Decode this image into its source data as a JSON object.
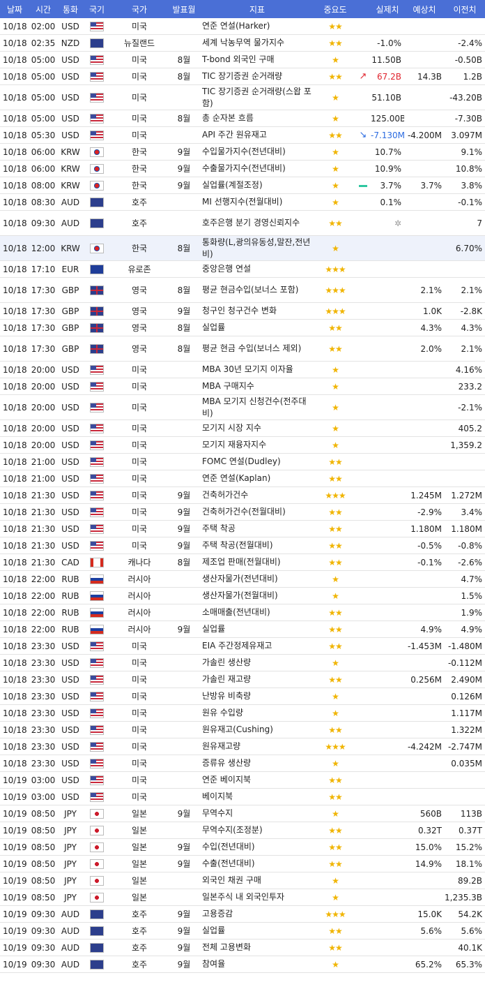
{
  "header": {
    "date": "날짜",
    "time": "시간",
    "currency": "통화",
    "flag": "국기",
    "country": "국가",
    "period": "발표월",
    "indicator": "지표",
    "importance": "중요도",
    "actual": "실제치",
    "forecast": "예상치",
    "previous": "이전치"
  },
  "rows": [
    {
      "date": "10/18",
      "time": "02:00",
      "cur": "USD",
      "flag": "us",
      "country": "미국",
      "period": "",
      "ind": "연준 연설(Harker)",
      "imp": "★★",
      "act": "",
      "fc": "",
      "prev": ""
    },
    {
      "date": "10/18",
      "time": "02:35",
      "cur": "NZD",
      "flag": "nz",
      "country": "뉴질랜드",
      "period": "",
      "ind": "세계 낙농무역 물가지수",
      "imp": "★★",
      "act": "-1.0%",
      "fc": "",
      "prev": "-2.4%"
    },
    {
      "date": "10/18",
      "time": "05:00",
      "cur": "USD",
      "flag": "us",
      "country": "미국",
      "period": "8월",
      "ind": "T-bond 외국인 구매",
      "imp": "★",
      "act": "11.50B",
      "fc": "",
      "prev": "-0.50B"
    },
    {
      "date": "10/18",
      "time": "05:00",
      "cur": "USD",
      "flag": "us",
      "country": "미국",
      "period": "8월",
      "ind": "TIC 장기증권 순거래량",
      "imp": "★★",
      "trend": "up",
      "act": "67.2B",
      "actClass": "neg",
      "fc": "14.3B",
      "prev": "1.2B"
    },
    {
      "date": "10/18",
      "time": "05:00",
      "cur": "USD",
      "flag": "us",
      "country": "미국",
      "period": "",
      "ind": "TIC 장기증권 순거래량(스왑 포함)",
      "imp": "★",
      "act": "51.10B",
      "fc": "",
      "prev": "-43.20B",
      "tall": true
    },
    {
      "date": "10/18",
      "time": "05:00",
      "cur": "USD",
      "flag": "us",
      "country": "미국",
      "period": "8월",
      "ind": "총 순자본 흐름",
      "imp": "★",
      "act": "125.00B",
      "fc": "",
      "prev": "-7.30B"
    },
    {
      "date": "10/18",
      "time": "05:30",
      "cur": "USD",
      "flag": "us",
      "country": "미국",
      "period": "",
      "ind": "API 주간 원유재고",
      "imp": "★★",
      "trend": "down",
      "act": "-7.130M",
      "actClass": "pos",
      "fc": "-4.200M",
      "prev": "3.097M"
    },
    {
      "date": "10/18",
      "time": "06:00",
      "cur": "KRW",
      "flag": "kr",
      "country": "한국",
      "period": "9월",
      "ind": "수입물가지수(전년대비)",
      "imp": "★",
      "act": "10.7%",
      "fc": "",
      "prev": "9.1%"
    },
    {
      "date": "10/18",
      "time": "06:00",
      "cur": "KRW",
      "flag": "kr",
      "country": "한국",
      "period": "9월",
      "ind": "수출물가지수(전년대비)",
      "imp": "★",
      "act": "10.9%",
      "fc": "",
      "prev": "10.8%"
    },
    {
      "date": "10/18",
      "time": "08:00",
      "cur": "KRW",
      "flag": "kr",
      "country": "한국",
      "period": "9월",
      "ind": "실업률(계절조정)",
      "imp": "★",
      "trend": "flat",
      "act": "3.7%",
      "fc": "3.7%",
      "prev": "3.8%"
    },
    {
      "date": "10/18",
      "time": "08:30",
      "cur": "AUD",
      "flag": "au",
      "country": "호주",
      "period": "",
      "ind": "MI 선행지수(전월대비)",
      "imp": "★",
      "act": "0.1%",
      "fc": "",
      "prev": "-0.1%"
    },
    {
      "date": "10/18",
      "time": "09:30",
      "cur": "AUD",
      "flag": "au",
      "country": "호주",
      "period": "",
      "ind": "호주은행 분기 경영신뢰지수",
      "imp": "★★",
      "spinner": true,
      "act": "",
      "fc": "",
      "prev": "7",
      "tall": true
    },
    {
      "date": "10/18",
      "time": "12:00",
      "cur": "KRW",
      "flag": "kr",
      "country": "한국",
      "period": "8월",
      "ind": "통화량(L,광의유동성,말잔,전년비)",
      "imp": "★",
      "act": "",
      "fc": "",
      "prev": "6.70%",
      "tall": true,
      "hl": true
    },
    {
      "date": "10/18",
      "time": "17:10",
      "cur": "EUR",
      "flag": "eu",
      "country": "유로존",
      "period": "",
      "ind": "중앙은행 연설",
      "imp": "★★★",
      "act": "",
      "fc": "",
      "prev": ""
    },
    {
      "date": "10/18",
      "time": "17:30",
      "cur": "GBP",
      "flag": "gb",
      "country": "영국",
      "period": "8월",
      "ind": "평균 현금수입(보너스 포함)",
      "imp": "★★★",
      "act": "",
      "fc": "2.1%",
      "prev": "2.1%",
      "tall": true
    },
    {
      "date": "10/18",
      "time": "17:30",
      "cur": "GBP",
      "flag": "gb",
      "country": "영국",
      "period": "9월",
      "ind": "청구인 청구건수 변화",
      "imp": "★★★",
      "act": "",
      "fc": "1.0K",
      "prev": "-2.8K"
    },
    {
      "date": "10/18",
      "time": "17:30",
      "cur": "GBP",
      "flag": "gb",
      "country": "영국",
      "period": "8월",
      "ind": "실업률",
      "imp": "★★",
      "act": "",
      "fc": "4.3%",
      "prev": "4.3%"
    },
    {
      "date": "10/18",
      "time": "17:30",
      "cur": "GBP",
      "flag": "gb",
      "country": "영국",
      "period": "8월",
      "ind": "평균 현금 수입(보너스 제외)",
      "imp": "★★",
      "act": "",
      "fc": "2.0%",
      "prev": "2.1%",
      "tall": true
    },
    {
      "date": "10/18",
      "time": "20:00",
      "cur": "USD",
      "flag": "us",
      "country": "미국",
      "period": "",
      "ind": "MBA 30년 모기지 이자율",
      "imp": "★",
      "act": "",
      "fc": "",
      "prev": "4.16%"
    },
    {
      "date": "10/18",
      "time": "20:00",
      "cur": "USD",
      "flag": "us",
      "country": "미국",
      "period": "",
      "ind": "MBA 구매지수",
      "imp": "★",
      "act": "",
      "fc": "",
      "prev": "233.2"
    },
    {
      "date": "10/18",
      "time": "20:00",
      "cur": "USD",
      "flag": "us",
      "country": "미국",
      "period": "",
      "ind": "MBA 모기지 신청건수(전주대비)",
      "imp": "★",
      "act": "",
      "fc": "",
      "prev": "-2.1%",
      "tall": true
    },
    {
      "date": "10/18",
      "time": "20:00",
      "cur": "USD",
      "flag": "us",
      "country": "미국",
      "period": "",
      "ind": "모기지 시장 지수",
      "imp": "★",
      "act": "",
      "fc": "",
      "prev": "405.2"
    },
    {
      "date": "10/18",
      "time": "20:00",
      "cur": "USD",
      "flag": "us",
      "country": "미국",
      "period": "",
      "ind": "모기지 재융자지수",
      "imp": "★",
      "act": "",
      "fc": "",
      "prev": "1,359.2"
    },
    {
      "date": "10/18",
      "time": "21:00",
      "cur": "USD",
      "flag": "us",
      "country": "미국",
      "period": "",
      "ind": "FOMC 연설(Dudley)",
      "imp": "★★",
      "act": "",
      "fc": "",
      "prev": ""
    },
    {
      "date": "10/18",
      "time": "21:00",
      "cur": "USD",
      "flag": "us",
      "country": "미국",
      "period": "",
      "ind": "연준 연설(Kaplan)",
      "imp": "★★",
      "act": "",
      "fc": "",
      "prev": ""
    },
    {
      "date": "10/18",
      "time": "21:30",
      "cur": "USD",
      "flag": "us",
      "country": "미국",
      "period": "9월",
      "ind": "건축허가건수",
      "imp": "★★★",
      "act": "",
      "fc": "1.245M",
      "prev": "1.272M"
    },
    {
      "date": "10/18",
      "time": "21:30",
      "cur": "USD",
      "flag": "us",
      "country": "미국",
      "period": "9월",
      "ind": "건축허가건수(전월대비)",
      "imp": "★★",
      "act": "",
      "fc": "-2.9%",
      "prev": "3.4%"
    },
    {
      "date": "10/18",
      "time": "21:30",
      "cur": "USD",
      "flag": "us",
      "country": "미국",
      "period": "9월",
      "ind": "주택 착공",
      "imp": "★★",
      "act": "",
      "fc": "1.180M",
      "prev": "1.180M"
    },
    {
      "date": "10/18",
      "time": "21:30",
      "cur": "USD",
      "flag": "us",
      "country": "미국",
      "period": "9월",
      "ind": "주택 착공(전월대비)",
      "imp": "★★",
      "act": "",
      "fc": "-0.5%",
      "prev": "-0.8%"
    },
    {
      "date": "10/18",
      "time": "21:30",
      "cur": "CAD",
      "flag": "ca",
      "country": "캐나다",
      "period": "8월",
      "ind": "제조업 판매(전월대비)",
      "imp": "★★",
      "act": "",
      "fc": "-0.1%",
      "prev": "-2.6%"
    },
    {
      "date": "10/18",
      "time": "22:00",
      "cur": "RUB",
      "flag": "ru",
      "country": "러시아",
      "period": "",
      "ind": "생산자물가(전년대비)",
      "imp": "★",
      "act": "",
      "fc": "",
      "prev": "4.7%"
    },
    {
      "date": "10/18",
      "time": "22:00",
      "cur": "RUB",
      "flag": "ru",
      "country": "러시아",
      "period": "",
      "ind": "생산자물가(전월대비)",
      "imp": "★",
      "act": "",
      "fc": "",
      "prev": "1.5%"
    },
    {
      "date": "10/18",
      "time": "22:00",
      "cur": "RUB",
      "flag": "ru",
      "country": "러시아",
      "period": "",
      "ind": "소매매출(전년대비)",
      "imp": "★★",
      "act": "",
      "fc": "",
      "prev": "1.9%"
    },
    {
      "date": "10/18",
      "time": "22:00",
      "cur": "RUB",
      "flag": "ru",
      "country": "러시아",
      "period": "9월",
      "ind": "실업률",
      "imp": "★★",
      "act": "",
      "fc": "4.9%",
      "prev": "4.9%"
    },
    {
      "date": "10/18",
      "time": "23:30",
      "cur": "USD",
      "flag": "us",
      "country": "미국",
      "period": "",
      "ind": "EIA 주간정제유재고",
      "imp": "★★",
      "act": "",
      "fc": "-1.453M",
      "prev": "-1.480M"
    },
    {
      "date": "10/18",
      "time": "23:30",
      "cur": "USD",
      "flag": "us",
      "country": "미국",
      "period": "",
      "ind": "가솔린 생산량",
      "imp": "★",
      "act": "",
      "fc": "",
      "prev": "-0.112M"
    },
    {
      "date": "10/18",
      "time": "23:30",
      "cur": "USD",
      "flag": "us",
      "country": "미국",
      "period": "",
      "ind": "가솔린 재고량",
      "imp": "★★",
      "act": "",
      "fc": "0.256M",
      "prev": "2.490M"
    },
    {
      "date": "10/18",
      "time": "23:30",
      "cur": "USD",
      "flag": "us",
      "country": "미국",
      "period": "",
      "ind": "난방유 비축량",
      "imp": "★",
      "act": "",
      "fc": "",
      "prev": "0.126M"
    },
    {
      "date": "10/18",
      "time": "23:30",
      "cur": "USD",
      "flag": "us",
      "country": "미국",
      "period": "",
      "ind": "원유 수입량",
      "imp": "★",
      "act": "",
      "fc": "",
      "prev": "1.117M"
    },
    {
      "date": "10/18",
      "time": "23:30",
      "cur": "USD",
      "flag": "us",
      "country": "미국",
      "period": "",
      "ind": "원유재고(Cushing)",
      "imp": "★★",
      "act": "",
      "fc": "",
      "prev": "1.322M"
    },
    {
      "date": "10/18",
      "time": "23:30",
      "cur": "USD",
      "flag": "us",
      "country": "미국",
      "period": "",
      "ind": "원유재고량",
      "imp": "★★★",
      "act": "",
      "fc": "-4.242M",
      "prev": "-2.747M"
    },
    {
      "date": "10/18",
      "time": "23:30",
      "cur": "USD",
      "flag": "us",
      "country": "미국",
      "period": "",
      "ind": "증류유 생산량",
      "imp": "★",
      "act": "",
      "fc": "",
      "prev": "0.035M"
    },
    {
      "date": "10/19",
      "time": "03:00",
      "cur": "USD",
      "flag": "us",
      "country": "미국",
      "period": "",
      "ind": "연준 베이지북",
      "imp": "★★",
      "act": "",
      "fc": "",
      "prev": ""
    },
    {
      "date": "10/19",
      "time": "03:00",
      "cur": "USD",
      "flag": "us",
      "country": "미국",
      "period": "",
      "ind": "베이지북",
      "imp": "★★",
      "act": "",
      "fc": "",
      "prev": ""
    },
    {
      "date": "10/19",
      "time": "08:50",
      "cur": "JPY",
      "flag": "jp",
      "country": "일본",
      "period": "9월",
      "ind": "무역수지",
      "imp": "★",
      "act": "",
      "fc": "560B",
      "prev": "113B"
    },
    {
      "date": "10/19",
      "time": "08:50",
      "cur": "JPY",
      "flag": "jp",
      "country": "일본",
      "period": "",
      "ind": "무역수지(조정분)",
      "imp": "★★",
      "act": "",
      "fc": "0.32T",
      "prev": "0.37T"
    },
    {
      "date": "10/19",
      "time": "08:50",
      "cur": "JPY",
      "flag": "jp",
      "country": "일본",
      "period": "9월",
      "ind": "수입(전년대비)",
      "imp": "★★",
      "act": "",
      "fc": "15.0%",
      "prev": "15.2%"
    },
    {
      "date": "10/19",
      "time": "08:50",
      "cur": "JPY",
      "flag": "jp",
      "country": "일본",
      "period": "9월",
      "ind": "수출(전년대비)",
      "imp": "★★",
      "act": "",
      "fc": "14.9%",
      "prev": "18.1%"
    },
    {
      "date": "10/19",
      "time": "08:50",
      "cur": "JPY",
      "flag": "jp",
      "country": "일본",
      "period": "",
      "ind": "외국인 채권 구매",
      "imp": "★",
      "act": "",
      "fc": "",
      "prev": "89.2B"
    },
    {
      "date": "10/19",
      "time": "08:50",
      "cur": "JPY",
      "flag": "jp",
      "country": "일본",
      "period": "",
      "ind": "일본주식 내 외국인투자",
      "imp": "★",
      "act": "",
      "fc": "",
      "prev": "1,235.3B"
    },
    {
      "date": "10/19",
      "time": "09:30",
      "cur": "AUD",
      "flag": "au",
      "country": "호주",
      "period": "9월",
      "ind": "고용증감",
      "imp": "★★★",
      "act": "",
      "fc": "15.0K",
      "prev": "54.2K"
    },
    {
      "date": "10/19",
      "time": "09:30",
      "cur": "AUD",
      "flag": "au",
      "country": "호주",
      "period": "9월",
      "ind": "실업률",
      "imp": "★★",
      "act": "",
      "fc": "5.6%",
      "prev": "5.6%"
    },
    {
      "date": "10/19",
      "time": "09:30",
      "cur": "AUD",
      "flag": "au",
      "country": "호주",
      "period": "9월",
      "ind": "전체 고용변화",
      "imp": "★★",
      "act": "",
      "fc": "",
      "prev": "40.1K"
    },
    {
      "date": "10/19",
      "time": "09:30",
      "cur": "AUD",
      "flag": "au",
      "country": "호주",
      "period": "9월",
      "ind": "참여율",
      "imp": "★",
      "act": "",
      "fc": "65.2%",
      "prev": "65.3%"
    }
  ]
}
